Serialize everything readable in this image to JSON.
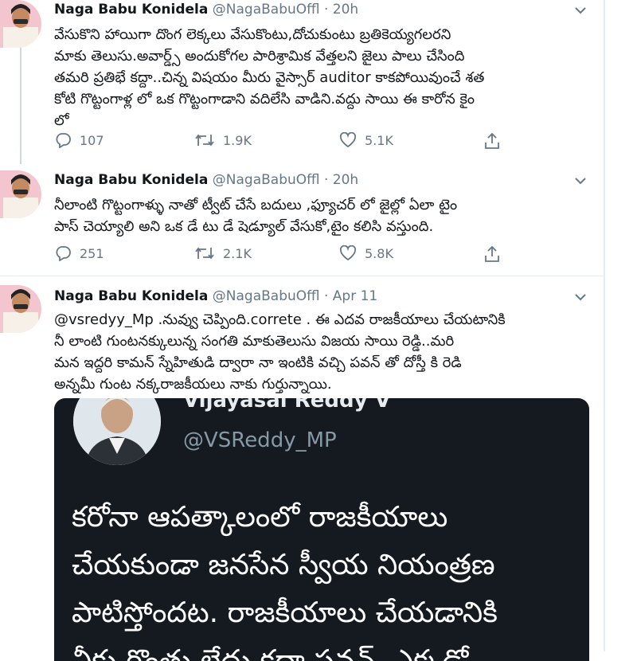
{
  "tweets": [
    {
      "name": "Naga Babu Konidela",
      "handle": "@NagaBabuOffl",
      "time": "20h",
      "lines": [
        "వేసుకొని హాయిగా దొంగ లెక్కలు వేసుకొంటు,దోచుకుంటు బ్రతికెయ్యగలరని",
        "మాకు తెలుసు.అవార్డ్స్ అందుకోగల పారిశ్రామిక వేత్తలని జైలు పాలు చేసింది",
        "తమరి ప్రతిభే కద్దా..చిన్న విషయం మీరు వైస్సార్ auditor కాకపోయివుంచే శత",
        "కోటి గొట్టంగాళ్ల లో ఒక గొట్టంగాడాని వదిలేసి వాడిని.వద్దు సాయి ఈ కారోన కైం",
        "లో"
      ],
      "reply_count": "107",
      "retweet_count": "1.9K",
      "like_count": "5.1K"
    },
    {
      "name": "Naga Babu Konidela",
      "handle": "@NagaBabuOffl",
      "time": "20h",
      "lines": [
        "నీలాంటి గొట్టంగాళ్ళు నాతో ట్వీట్ చేసే బదులు ,ఫ్యూచర్ లో జైల్లో ఏలా టైం",
        "పాస్ చెయ్యాలి అని ఒక డే టు డే షెడ్యూల్ వేసుకో,టైం కలిసి వస్తుంది."
      ],
      "reply_count": "251",
      "retweet_count": "2.1K",
      "like_count": "5.8K"
    },
    {
      "name": "Naga Babu Konidela",
      "handle": "@NagaBabuOffl",
      "time": "Apr 11",
      "lines": [
        "@vsredyy_Mp  .నువ్వు చెప్పింది.correte . ఈ ఎదవ రాజకీయాలు చేయటానికి",
        "నీ లాంటి గుంటనక్కులున్న సంగతి  మాకుతెలుసు విజయ సాయి రెడ్డి..మరి",
        "మన ఇద్దరి కామన్ స్నేహితుడి ద్వారా నా ఇంటికి వచ్చి పవన్ తో దోస్తీ కి రెడి",
        "అన్నమీ గుంట నక్కరాజకీయలు నాకు గుర్తున్నాయి."
      ]
    }
  ],
  "embed": {
    "name": "Vijayasai Reddy V",
    "handle": "@VSReddy_MP",
    "lines": [
      "కరోనా ఆపత్కాలంలో రాజకీయాలు",
      "చేయకుండా జనసేన స్వీయ నియంత్రణ",
      "పాటిస్తోందట. రాజకీయాలు చేయడానికి",
      "నీకు గొంతు లేదు కదా పవన్. ఎక్కడో"
    ]
  },
  "icons": {
    "reply": "reply-icon",
    "retweet": "retweet-icon",
    "like": "like-icon",
    "share": "share-icon",
    "caret": "chevron-down-icon"
  },
  "colors": {
    "muted": "#657786",
    "embed_bg": "#141a20",
    "avatar_bg": "#f3c6cf"
  }
}
